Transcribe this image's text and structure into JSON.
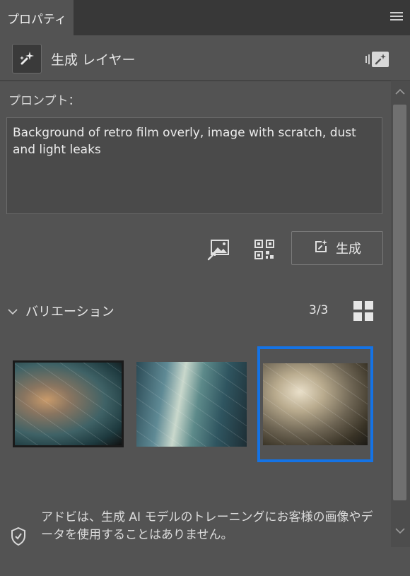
{
  "tab": {
    "title": "プロパティ"
  },
  "header": {
    "layer_title": "生成 レイヤー"
  },
  "prompt": {
    "label": "プロンプト：",
    "text": "Background of retro film overly, image with scratch, dust and light leaks"
  },
  "actions": {
    "generate_label": "生成"
  },
  "variations": {
    "label": "バリエーション",
    "count": "3/3",
    "selected_index": 3
  },
  "footer": {
    "notice": "アドビは、生成 AI モデルのトレーニングにお客様の画像やデータを使用することはありません。"
  },
  "colors": {
    "selection": "#1473e6",
    "panel": "#535353",
    "tabbar": "#383838"
  },
  "icons": [
    "menu-icon",
    "generative-layer-icon",
    "generative-fill-icon",
    "image-reference-icon",
    "qr-icon",
    "generate-icon",
    "chevron-down-icon",
    "grid-view-icon",
    "shield-icon"
  ]
}
